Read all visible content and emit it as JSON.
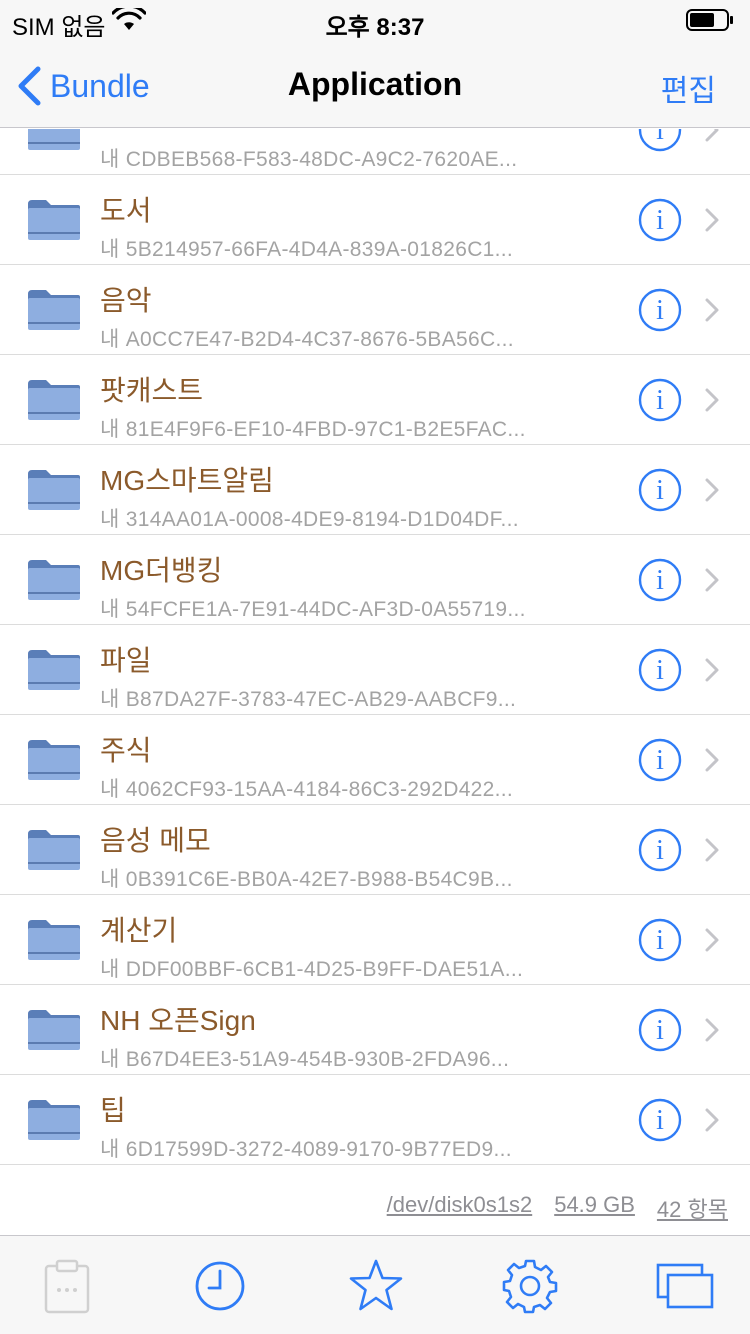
{
  "status_bar": {
    "carrier": "SIM 없음",
    "time": "오후 8:37"
  },
  "navbar": {
    "back_label": "Bundle",
    "title": "Application",
    "edit_label": "편집"
  },
  "list": {
    "items": [
      {
        "title": "",
        "subtitle": "내 CDBEB568-F583-48DC-A9C2-7620AE..."
      },
      {
        "title": "도서",
        "subtitle": "내 5B214957-66FA-4D4A-839A-01826C1..."
      },
      {
        "title": "음악",
        "subtitle": "내 A0CC7E47-B2D4-4C37-8676-5BA56C..."
      },
      {
        "title": "팟캐스트",
        "subtitle": "내 81E4F9F6-EF10-4FBD-97C1-B2E5FAC..."
      },
      {
        "title": "MG스마트알림",
        "subtitle": "내 314AA01A-0008-4DE9-8194-D1D04DF..."
      },
      {
        "title": "MG더뱅킹",
        "subtitle": "내 54FCFE1A-7E91-44DC-AF3D-0A55719..."
      },
      {
        "title": "파일",
        "subtitle": "내 B87DA27F-3783-47EC-AB29-AABCF9..."
      },
      {
        "title": "주식",
        "subtitle": "내 4062CF93-15AA-4184-86C3-292D422..."
      },
      {
        "title": "음성 메모",
        "subtitle": "내 0B391C6E-BB0A-42E7-B988-B54C9B..."
      },
      {
        "title": "계산기",
        "subtitle": "내 DDF00BBF-6CB1-4D25-B9FF-DAE51A..."
      },
      {
        "title": "NH 오픈Sign",
        "subtitle": "내 B67D4EE3-51A9-454B-930B-2FDA96..."
      },
      {
        "title": "팁",
        "subtitle": "내 6D17599D-3272-4089-9170-9B77ED9..."
      }
    ]
  },
  "footer": {
    "disk": "/dev/disk0s1s2",
    "size": "54.9 GB",
    "count": "42 항목"
  },
  "tabbar": {
    "tabs": [
      "clipboard-icon",
      "clock-icon",
      "star-icon",
      "gear-icon",
      "windows-icon"
    ]
  },
  "colors": {
    "accent": "#2f7cf6",
    "title_brown": "#8b5a2b",
    "folder": "#8eaee0"
  }
}
